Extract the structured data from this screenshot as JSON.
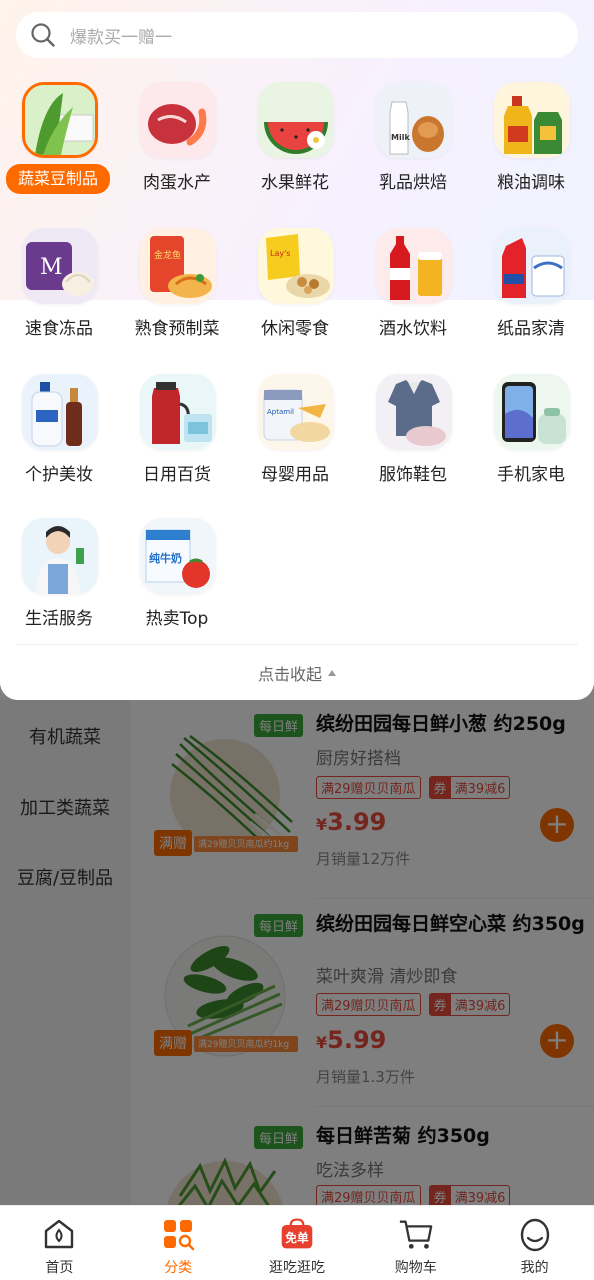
{
  "search": {
    "placeholder": "爆款买一赠一"
  },
  "categories": [
    {
      "label": "蔬菜豆制品",
      "icon": "vegetable-tofu-icon",
      "active": true
    },
    {
      "label": "肉蛋水产",
      "icon": "meat-seafood-icon"
    },
    {
      "label": "水果鲜花",
      "icon": "fruit-flower-icon"
    },
    {
      "label": "乳品烘焙",
      "icon": "dairy-bakery-icon"
    },
    {
      "label": "粮油调味",
      "icon": "grain-oil-icon"
    },
    {
      "label": "速食冻品",
      "icon": "frozen-food-icon"
    },
    {
      "label": "熟食预制菜",
      "icon": "prepared-food-icon"
    },
    {
      "label": "休闲零食",
      "icon": "snack-icon"
    },
    {
      "label": "酒水饮料",
      "icon": "beverage-icon"
    },
    {
      "label": "纸品家清",
      "icon": "paper-cleaning-icon"
    },
    {
      "label": "个护美妆",
      "icon": "personal-care-icon"
    },
    {
      "label": "日用百货",
      "icon": "daily-goods-icon"
    },
    {
      "label": "母婴用品",
      "icon": "baby-products-icon"
    },
    {
      "label": "服饰鞋包",
      "icon": "apparel-icon"
    },
    {
      "label": "手机家电",
      "icon": "phone-appliance-icon"
    },
    {
      "label": "生活服务",
      "icon": "life-service-icon"
    },
    {
      "label": "热卖Top",
      "icon": "hot-sale-icon"
    }
  ],
  "collapse_label": "点击收起",
  "side_nav": [
    "有机蔬菜",
    "加工类蔬菜",
    "豆腐/豆制品"
  ],
  "products": [
    {
      "title": "缤纷田园每日鲜小葱 约250g",
      "subtitle": "厨房好搭档",
      "fresh_tag": "每日鲜",
      "promo_tag": "满赠",
      "promo_gift": "满29赠贝贝南瓜约1kg",
      "coupon_gift": "满29赠贝贝南瓜",
      "coupon_q": "券",
      "coupon_off": "满39减6",
      "price_symbol": "¥",
      "price": "3.99",
      "sales": "月销量12万件"
    },
    {
      "title": "缤纷田园每日鲜空心菜 约350g",
      "subtitle": "菜叶爽滑 清炒即食",
      "fresh_tag": "每日鲜",
      "promo_tag": "满赠",
      "promo_gift": "满29赠贝贝南瓜约1kg",
      "coupon_gift": "满29赠贝贝南瓜",
      "coupon_q": "券",
      "coupon_off": "满39减6",
      "price_symbol": "¥",
      "price": "5.99",
      "sales": "月销量1.3万件"
    },
    {
      "title": "每日鲜苦菊 约350g",
      "subtitle": "吃法多样",
      "fresh_tag": "每日鲜",
      "coupon_gift": "满29赠贝贝南瓜",
      "coupon_q": "券",
      "coupon_off": "满39减6"
    }
  ],
  "tabbar": [
    {
      "label": "首页",
      "icon": "home-icon"
    },
    {
      "label": "分类",
      "icon": "category-icon",
      "active": true
    },
    {
      "label": "逛吃逛吃",
      "icon": "free-order-icon",
      "badge": "免单"
    },
    {
      "label": "购物车",
      "icon": "cart-icon"
    },
    {
      "label": "我的",
      "icon": "profile-icon"
    }
  ],
  "colors": {
    "accent": "#ff6a00",
    "price": "#e84b3c",
    "fresh_tag": "#3aa639"
  }
}
